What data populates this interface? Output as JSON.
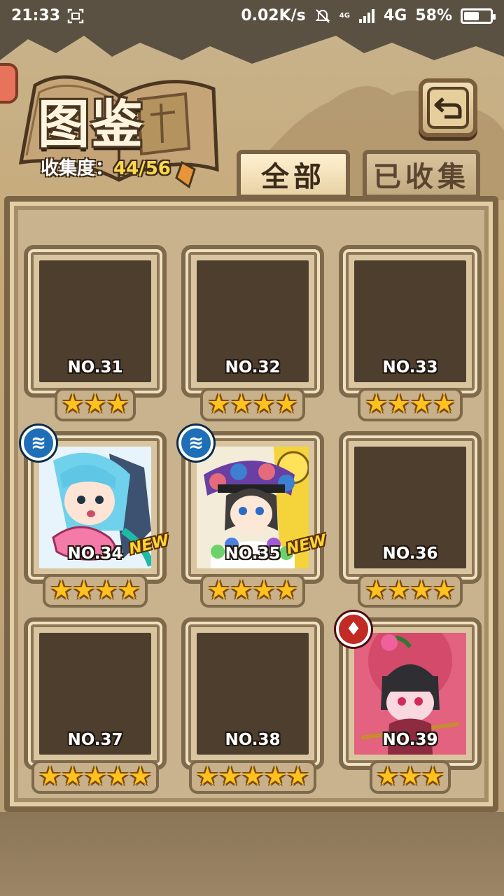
{
  "status_bar": {
    "time": "21:33",
    "network_speed": "0.02K/s",
    "network_type_small": "4G",
    "network_type": "4G",
    "battery": "58%",
    "battery_level": 0.58
  },
  "header": {
    "title": "图鉴",
    "collection_label": "收集度：",
    "collection_value": "44/56"
  },
  "tabs": [
    {
      "label": "全部",
      "selected": true
    },
    {
      "label": "已收集",
      "selected": false
    }
  ],
  "cards": [
    {
      "number": "NO.31",
      "stars": 3,
      "collected": false,
      "element": "",
      "new": false
    },
    {
      "number": "NO.32",
      "stars": 4,
      "collected": false,
      "element": "",
      "new": false
    },
    {
      "number": "NO.33",
      "stars": 4,
      "collected": false,
      "element": "",
      "new": false
    },
    {
      "number": "NO.34",
      "stars": 4,
      "collected": true,
      "element": "water",
      "new": true
    },
    {
      "number": "NO.35",
      "stars": 4,
      "collected": true,
      "element": "water",
      "new": true
    },
    {
      "number": "NO.36",
      "stars": 4,
      "collected": false,
      "element": "",
      "new": false
    },
    {
      "number": "NO.37",
      "stars": 5,
      "collected": false,
      "element": "",
      "new": false
    },
    {
      "number": "NO.38",
      "stars": 5,
      "collected": false,
      "element": "",
      "new": false
    },
    {
      "number": "NO.39",
      "stars": 3,
      "collected": true,
      "element": "fire",
      "new": false
    }
  ],
  "new_tag_label": "NEW",
  "colors": {
    "water": "#1e6fb7",
    "fire": "#c22b24",
    "star": "#ffc21f",
    "collection_value": "#ffd84a"
  },
  "icons": {
    "water_element": "water-element-icon",
    "fire_element": "fire-element-icon",
    "back": "back-arrow-icon",
    "screenshot": "screenshot-icon",
    "mute": "mute-icon",
    "signal": "signal-icon",
    "battery": "battery-icon"
  }
}
